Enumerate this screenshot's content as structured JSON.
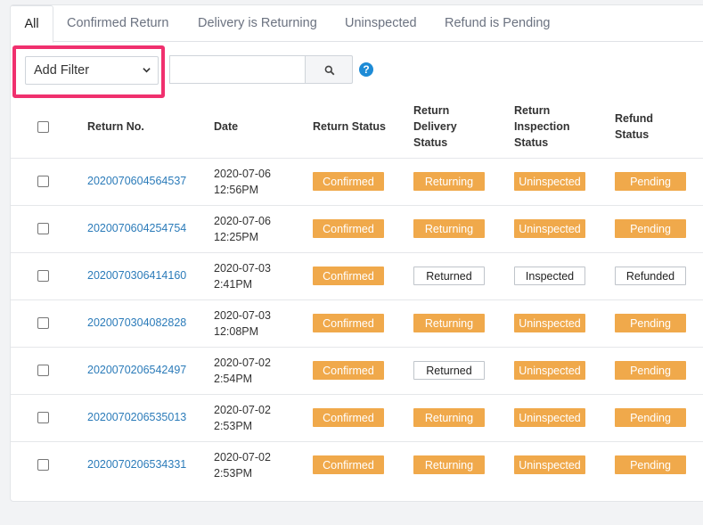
{
  "tabs": [
    {
      "label": "All",
      "active": true
    },
    {
      "label": "Confirmed Return",
      "active": false
    },
    {
      "label": "Delivery is Returning",
      "active": false
    },
    {
      "label": "Uninspected",
      "active": false
    },
    {
      "label": "Refund is Pending",
      "active": false
    }
  ],
  "filter": {
    "select_value": "Add Filter",
    "search_value": "",
    "help_label": "?"
  },
  "table": {
    "headers": {
      "return_no": "Return No.",
      "date": "Date",
      "return_status": "Return Status",
      "delivery_l1": "Return",
      "delivery_l2": "Delivery",
      "delivery_l3": "Status",
      "inspection_l1": "Return",
      "inspection_l2": "Inspection",
      "inspection_l3": "Status",
      "refund_l1": "Refund",
      "refund_l2": "Status"
    },
    "rows": [
      {
        "return_no": "2020070604564537",
        "date": "2020-07-06",
        "time": "12:56PM",
        "return_status": "Confirmed",
        "delivery_status": "Returning",
        "inspection_status": "Uninspected",
        "refund_status": "Pending"
      },
      {
        "return_no": "2020070604254754",
        "date": "2020-07-06",
        "time": "12:25PM",
        "return_status": "Confirmed",
        "delivery_status": "Returning",
        "inspection_status": "Uninspected",
        "refund_status": "Pending"
      },
      {
        "return_no": "2020070306414160",
        "date": "2020-07-03",
        "time": "2:41PM",
        "return_status": "Confirmed",
        "delivery_status": "Returned",
        "inspection_status": "Inspected",
        "refund_status": "Refunded"
      },
      {
        "return_no": "2020070304082828",
        "date": "2020-07-03",
        "time": "12:08PM",
        "return_status": "Confirmed",
        "delivery_status": "Returning",
        "inspection_status": "Uninspected",
        "refund_status": "Pending"
      },
      {
        "return_no": "2020070206542497",
        "date": "2020-07-02",
        "time": "2:54PM",
        "return_status": "Confirmed",
        "delivery_status": "Returned",
        "inspection_status": "Uninspected",
        "refund_status": "Pending"
      },
      {
        "return_no": "2020070206535013",
        "date": "2020-07-02",
        "time": "2:53PM",
        "return_status": "Confirmed",
        "delivery_status": "Returning",
        "inspection_status": "Uninspected",
        "refund_status": "Pending"
      },
      {
        "return_no": "2020070206534331",
        "date": "2020-07-02",
        "time": "2:53PM",
        "return_status": "Confirmed",
        "delivery_status": "Returning",
        "inspection_status": "Uninspected",
        "refund_status": "Pending"
      }
    ]
  },
  "icons": {
    "search": "search-icon",
    "chevron": "chevron-down-icon",
    "help": "help-icon"
  },
  "colors": {
    "pending_badge": "#f0a94b",
    "link": "#2b7bb9",
    "highlight": "#f0306e",
    "help": "#1d8bd6"
  }
}
